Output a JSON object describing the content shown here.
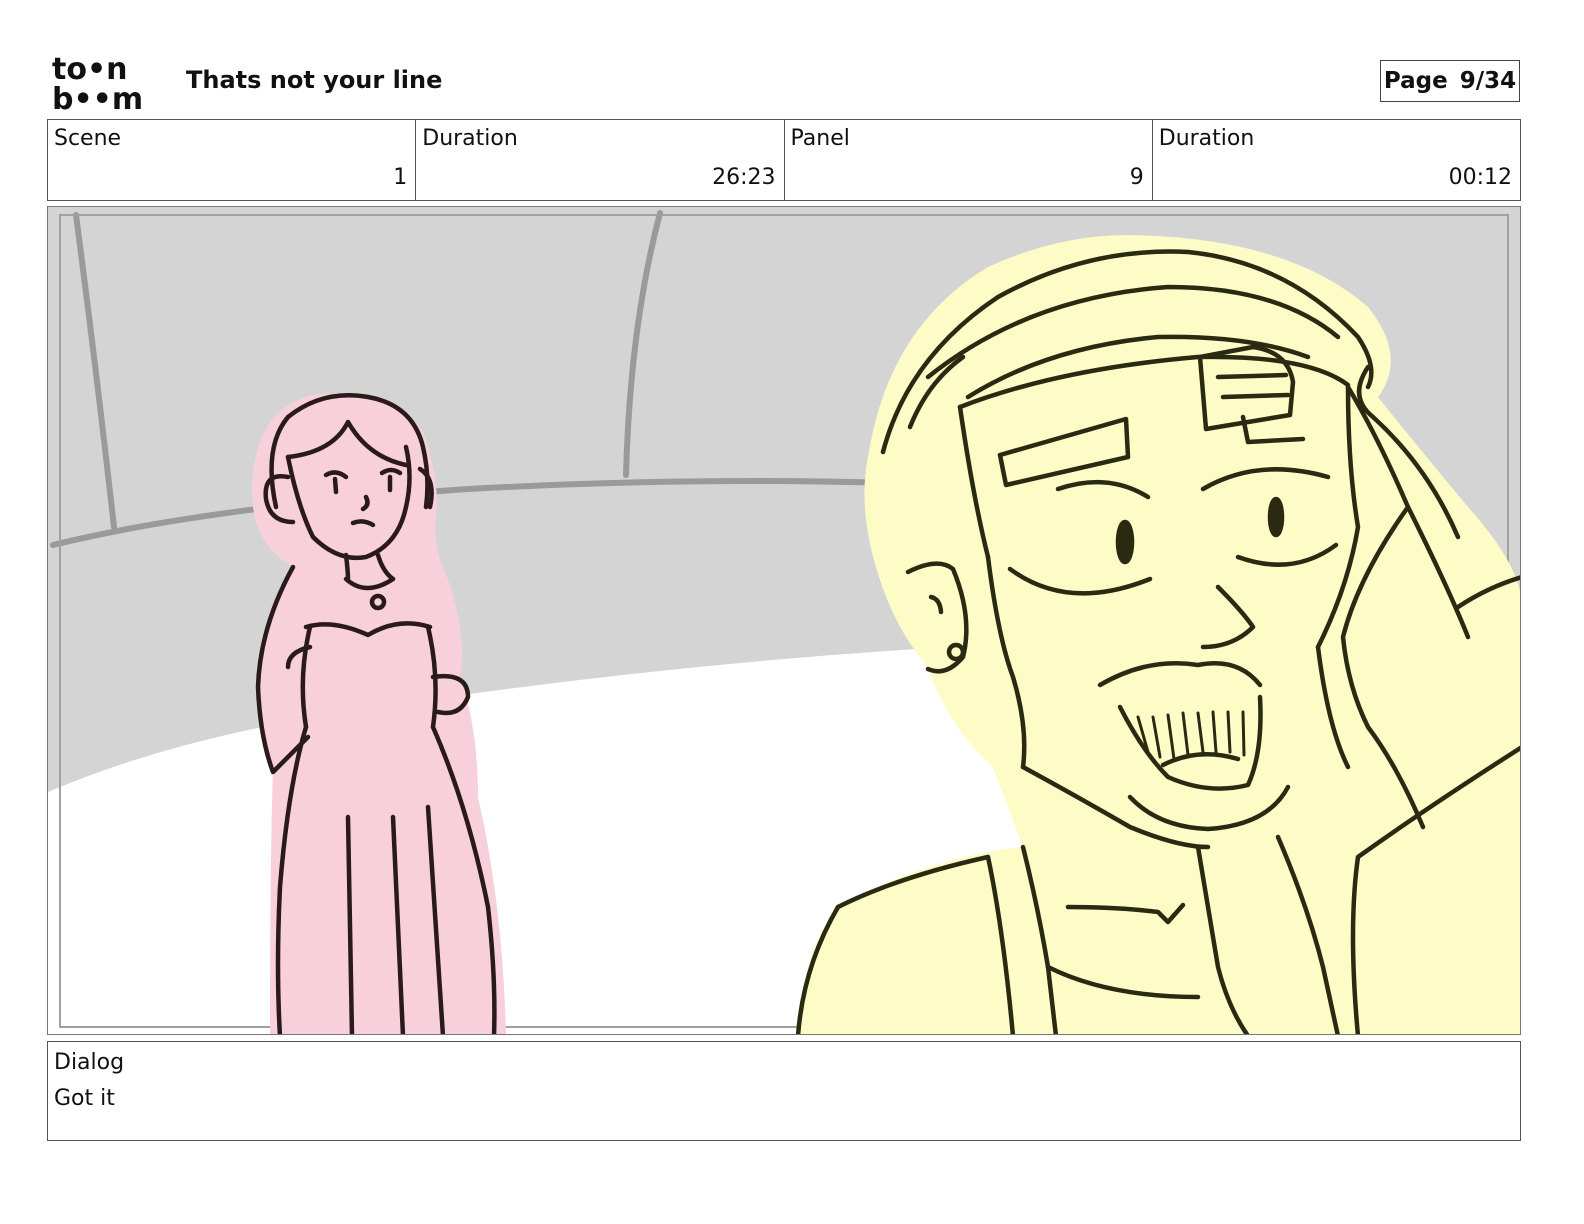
{
  "header": {
    "logo_top": "to•n",
    "logo_bottom": "b••m",
    "title": "Thats not your line",
    "page_label": "Page",
    "page_number": "9/34"
  },
  "info": {
    "scene_label": "Scene",
    "scene_value": "1",
    "scene_duration_label": "Duration",
    "scene_duration_value": "26:23",
    "panel_label": "Panel",
    "panel_value": "9",
    "panel_duration_label": "Duration",
    "panel_duration_value": "00:12"
  },
  "dialog": {
    "label": "Dialog",
    "text": "Got it"
  },
  "colors": {
    "wall": "#d4d4d4",
    "floor": "#ffffff",
    "girl_fill": "#f8d0dc",
    "boy_fill": "#fdfbc6",
    "line": "#2a1a1a"
  }
}
